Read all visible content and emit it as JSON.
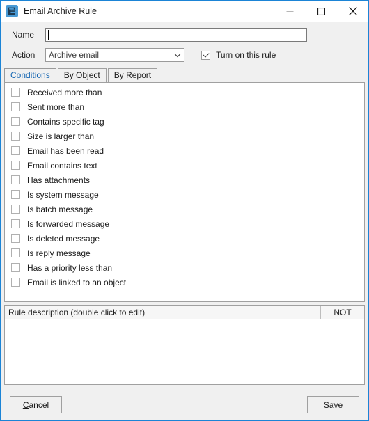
{
  "window": {
    "title": "Email Archive Rule",
    "icon": "email-rule-icon",
    "accent_color": "#1b84d6",
    "controls": {
      "minimize": "minimize-icon",
      "maximize": "maximize-icon",
      "close": "close-icon"
    }
  },
  "form": {
    "name_label": "Name",
    "name_value": "",
    "name_placeholder": "",
    "action_label": "Action",
    "action_selected": "Archive email",
    "action_options": [
      "Archive email"
    ],
    "enable_label": "Turn on this rule",
    "enable_checked": true
  },
  "tabs": [
    {
      "label": "Conditions",
      "active": true
    },
    {
      "label": "By Object",
      "active": false
    },
    {
      "label": "By Report",
      "active": false
    }
  ],
  "conditions": [
    {
      "label": "Received more than",
      "checked": false
    },
    {
      "label": "Sent more than",
      "checked": false
    },
    {
      "label": "Contains specific tag",
      "checked": false
    },
    {
      "label": "Size is larger than",
      "checked": false
    },
    {
      "label": "Email has been read",
      "checked": false
    },
    {
      "label": "Email contains text",
      "checked": false
    },
    {
      "label": "Has attachments",
      "checked": false
    },
    {
      "label": "Is system message",
      "checked": false
    },
    {
      "label": "Is batch message",
      "checked": false
    },
    {
      "label": "Is forwarded message",
      "checked": false
    },
    {
      "label": "Is deleted message",
      "checked": false
    },
    {
      "label": "Is reply message",
      "checked": false
    },
    {
      "label": "Has a priority less than",
      "checked": false
    },
    {
      "label": "Email is linked to an object",
      "checked": false
    }
  ],
  "description": {
    "header_main": "Rule description (double click to edit)",
    "header_not": "NOT",
    "rows": []
  },
  "footer": {
    "cancel_label": "Cancel",
    "cancel_accel": "C",
    "save_label": "Save"
  }
}
